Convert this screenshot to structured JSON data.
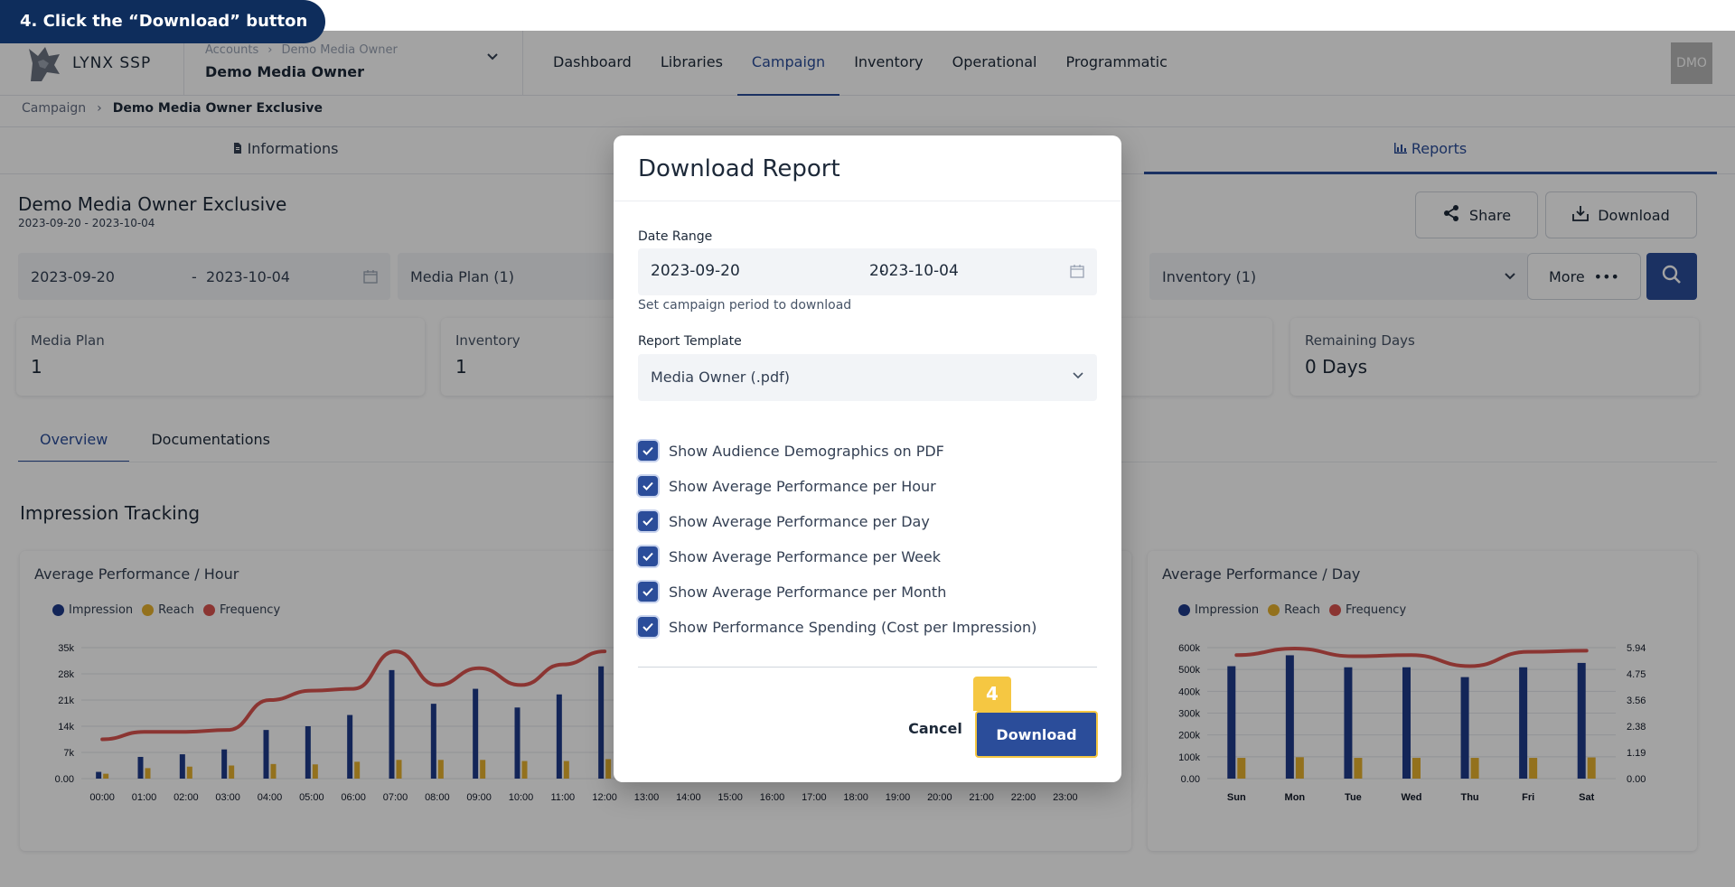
{
  "tutorial": {
    "step_text": "4. Click the “Download” button"
  },
  "header": {
    "logo_text": "LYNX SSP",
    "account_crumb_root": "Accounts",
    "account_crumb_sep": "›",
    "account_crumb_leaf": "Demo Media Owner",
    "account_name": "Demo Media Owner",
    "avatar_text": "DMO",
    "nav": [
      "Dashboard",
      "Libraries",
      "Campaign",
      "Inventory",
      "Operational",
      "Programmatic"
    ],
    "nav_active": "Campaign"
  },
  "breadcrumb": {
    "root": "Campaign",
    "sep": "›",
    "current": "Demo Media Owner Exclusive"
  },
  "page_tabs": {
    "informations": "Informations",
    "reports": "Reports"
  },
  "campaign": {
    "title": "Demo Media Owner Exclusive",
    "dates": "2023-09-20 - 2023-10-04",
    "share_label": "Share",
    "download_label": "Download"
  },
  "filters": {
    "date_start": "2023-09-20",
    "date_sep": "-",
    "date_end": "2023-10-04",
    "media_plan": "Media Plan (1)",
    "inventory": "Inventory (1)",
    "more_label": "More",
    "more_icon": "•••"
  },
  "stats": [
    {
      "label": "Media Plan",
      "value": "1"
    },
    {
      "label": "Inventory",
      "value": "1"
    },
    {
      "label": "Remaining Days",
      "value": "0 Days"
    }
  ],
  "sub_tabs": [
    "Overview",
    "Documentations"
  ],
  "section_title": "Impression Tracking",
  "legend": {
    "impression": "Impression",
    "reach": "Reach",
    "frequency": "Frequency"
  },
  "colors": {
    "impression": "#1f3a8a",
    "reach": "#e6b12e",
    "frequency": "#d9534f",
    "accent": "#2b4d9a"
  },
  "chart_data": [
    {
      "type": "bar",
      "title": "Average Performance / Hour",
      "categories": [
        "00:00",
        "01:00",
        "02:00",
        "03:00",
        "04:00",
        "05:00",
        "06:00",
        "07:00",
        "08:00",
        "09:00",
        "10:00",
        "11:00",
        "12:00",
        "13:00",
        "14:00",
        "15:00",
        "16:00",
        "17:00",
        "18:00",
        "19:00",
        "20:00",
        "21:00",
        "22:00",
        "23:00"
      ],
      "y_ticks": [
        "0.00",
        "7k",
        "14k",
        "21k",
        "28k",
        "35k"
      ],
      "ylim": [
        0,
        35000
      ],
      "series": [
        {
          "name": "Impression",
          "values": [
            1800,
            5800,
            6500,
            7800,
            13000,
            14000,
            17000,
            29000,
            20000,
            24000,
            19000,
            22500,
            30000,
            0,
            0,
            0,
            0,
            0,
            0,
            0,
            0,
            0,
            0,
            0
          ]
        },
        {
          "name": "Reach",
          "values": [
            1300,
            2800,
            3200,
            3500,
            3900,
            3800,
            4500,
            5000,
            5000,
            5000,
            4700,
            4700,
            5200,
            0,
            0,
            0,
            0,
            0,
            0,
            0,
            0,
            0,
            0,
            0
          ]
        },
        {
          "name": "Frequency",
          "values": [
            10500,
            12500,
            12500,
            13000,
            21000,
            23500,
            24000,
            34000,
            25000,
            29500,
            25000,
            30500,
            34000
          ]
        }
      ]
    },
    {
      "type": "bar",
      "title": "Average Performance / Day",
      "categories": [
        "Sun",
        "Mon",
        "Tue",
        "Wed",
        "Thu",
        "Fri",
        "Sat"
      ],
      "y_ticks": [
        "0.00",
        "100k",
        "200k",
        "300k",
        "400k",
        "500k",
        "600k"
      ],
      "ylim": [
        0,
        600000
      ],
      "y2_ticks": [
        "0.00",
        "1.19",
        "2.38",
        "3.56",
        "4.75",
        "5.94"
      ],
      "y2lim": [
        0,
        5.94
      ],
      "series": [
        {
          "name": "Impression",
          "values": [
            515000,
            565000,
            510000,
            510000,
            465000,
            510000,
            530000
          ]
        },
        {
          "name": "Reach",
          "values": [
            95000,
            98000,
            95000,
            95000,
            95000,
            95000,
            97000
          ]
        },
        {
          "name": "Frequency",
          "values": [
            5.6,
            5.9,
            5.55,
            5.6,
            5.1,
            5.75,
            5.8
          ]
        }
      ]
    }
  ],
  "modal": {
    "title": "Download Report",
    "date_range_label": "Date Range",
    "date_start": "2023-09-20",
    "date_sep": "-",
    "date_end": "2023-10-04",
    "date_help": "Set campaign period to download",
    "template_label": "Report Template",
    "template_value": "Media Owner (.pdf)",
    "options": [
      "Show Audience Demographics on PDF",
      "Show Average Performance per Hour",
      "Show Average Performance per Day",
      "Show Average Performance per Week",
      "Show Average Performance per Month",
      "Show Performance Spending (Cost per Impression)"
    ],
    "cancel_label": "Cancel",
    "download_label": "Download",
    "step_number": "4"
  }
}
